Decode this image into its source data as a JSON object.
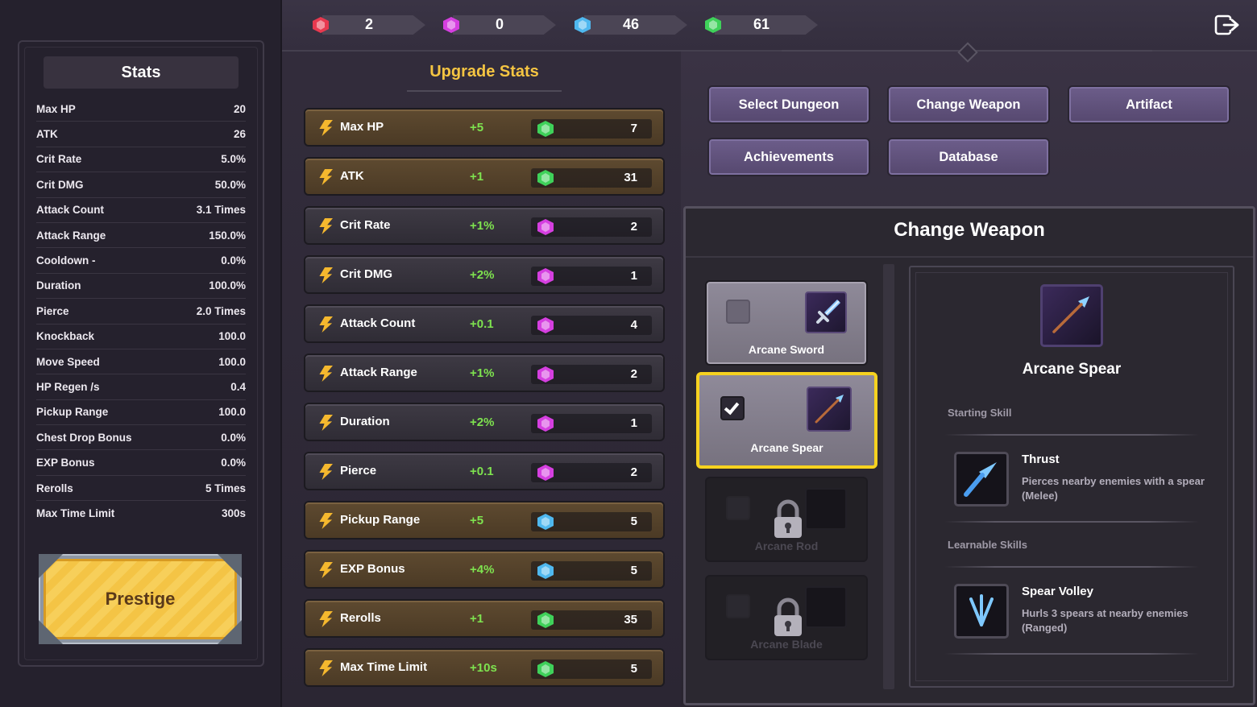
{
  "currencies": [
    {
      "name": "red-gem",
      "value": "2",
      "color": "#e8394f"
    },
    {
      "name": "purple-gem",
      "value": "0",
      "color": "#d53fe0"
    },
    {
      "name": "blue-gem",
      "value": "46",
      "color": "#4fb8ef"
    },
    {
      "name": "green-gem",
      "value": "61",
      "color": "#3fd15a"
    }
  ],
  "stats_panel": {
    "title": "Stats",
    "rows": [
      {
        "label": "Max HP",
        "value": "20"
      },
      {
        "label": "ATK",
        "value": "26"
      },
      {
        "label": "Crit Rate",
        "value": "5.0%"
      },
      {
        "label": "Crit DMG",
        "value": "50.0%"
      },
      {
        "label": "Attack Count",
        "value": "3.1 Times"
      },
      {
        "label": "Attack Range",
        "value": "150.0%"
      },
      {
        "label": "Cooldown -",
        "value": "0.0%"
      },
      {
        "label": "Duration",
        "value": "100.0%"
      },
      {
        "label": "Pierce",
        "value": "2.0 Times"
      },
      {
        "label": "Knockback",
        "value": "100.0"
      },
      {
        "label": "Move Speed",
        "value": "100.0"
      },
      {
        "label": "HP Regen /s",
        "value": "0.4"
      },
      {
        "label": "Pickup Range",
        "value": "100.0"
      },
      {
        "label": "Chest Drop Bonus",
        "value": "0.0%"
      },
      {
        "label": "EXP Bonus",
        "value": "0.0%"
      },
      {
        "label": "Rerolls",
        "value": "5 Times"
      },
      {
        "label": "Max Time Limit",
        "value": "300s"
      }
    ],
    "prestige_label": "Prestige"
  },
  "upgrade_stats": {
    "title": "Upgrade Stats",
    "rows": [
      {
        "label": "Max HP",
        "delta": "+5",
        "cost": "7",
        "currency": "green-gem",
        "style": "gold"
      },
      {
        "label": "ATK",
        "delta": "+1",
        "cost": "31",
        "currency": "green-gem",
        "style": "gold"
      },
      {
        "label": "Crit Rate",
        "delta": "+1%",
        "cost": "2",
        "currency": "purple-gem",
        "style": "dark"
      },
      {
        "label": "Crit DMG",
        "delta": "+2%",
        "cost": "1",
        "currency": "purple-gem",
        "style": "dark"
      },
      {
        "label": "Attack Count",
        "delta": "+0.1",
        "cost": "4",
        "currency": "purple-gem",
        "style": "dark"
      },
      {
        "label": "Attack Range",
        "delta": "+1%",
        "cost": "2",
        "currency": "purple-gem",
        "style": "dark"
      },
      {
        "label": "Duration",
        "delta": "+2%",
        "cost": "1",
        "currency": "purple-gem",
        "style": "dark"
      },
      {
        "label": "Pierce",
        "delta": "+0.1",
        "cost": "2",
        "currency": "purple-gem",
        "style": "dark"
      },
      {
        "label": "Pickup Range",
        "delta": "+5",
        "cost": "5",
        "currency": "blue-gem",
        "style": "gold"
      },
      {
        "label": "EXP Bonus",
        "delta": "+4%",
        "cost": "5",
        "currency": "blue-gem",
        "style": "gold"
      },
      {
        "label": "Rerolls",
        "delta": "+1",
        "cost": "35",
        "currency": "green-gem",
        "style": "gold"
      },
      {
        "label": "Max Time Limit",
        "delta": "+10s",
        "cost": "5",
        "currency": "green-gem",
        "style": "gold"
      }
    ]
  },
  "nav": {
    "select_dungeon": "Select Dungeon",
    "change_weapon": "Change Weapon",
    "artifact": "Artifact",
    "achievements": "Achievements",
    "database": "Database"
  },
  "change_weapon": {
    "title": "Change Weapon",
    "weapons": [
      {
        "name": "Arcane Sword",
        "state": "unlocked"
      },
      {
        "name": "Arcane Spear",
        "state": "selected"
      },
      {
        "name": "Arcane Rod",
        "state": "locked"
      },
      {
        "name": "Arcane Blade",
        "state": "locked"
      }
    ],
    "detail": {
      "name": "Arcane Spear",
      "starting_skill_label": "Starting Skill",
      "starting_skill": {
        "name": "Thrust",
        "description": "Pierces nearby enemies with a spear (Melee)"
      },
      "learnable_skills_label": "Learnable Skills",
      "learnable_skill": {
        "name": "Spear Volley",
        "description": "Hurls 3 spears at nearby enemies (Ranged)"
      }
    }
  },
  "colors": {
    "accent_gold": "#f5c542",
    "delta_green": "#7ee34f",
    "selected_border": "#f6d21f",
    "nav_button": "#6c5d8a"
  }
}
